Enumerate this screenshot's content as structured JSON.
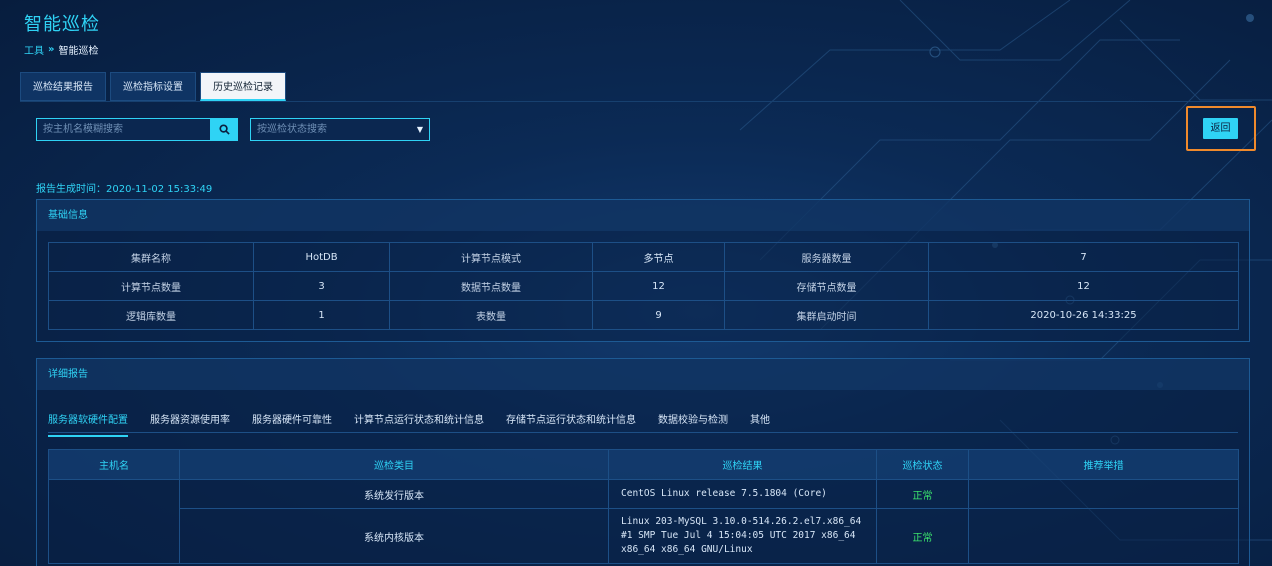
{
  "app": {
    "title": "智能巡检"
  },
  "breadcrumb": {
    "root": "工具",
    "current": "智能巡检"
  },
  "tabs": [
    {
      "label": "巡检结果报告",
      "active": false
    },
    {
      "label": "巡检指标设置",
      "active": false
    },
    {
      "label": "历史巡检记录",
      "active": true
    }
  ],
  "search": {
    "placeholder": "按主机名模糊搜索",
    "value": ""
  },
  "status_filter": {
    "placeholder": "按巡检状态搜索"
  },
  "back_label": "返回",
  "report_time": "报告生成时间：2020-11-02 15:33:49",
  "basic_info": {
    "title": "基础信息",
    "rows": [
      [
        "集群名称",
        "HotDB",
        "计算节点模式",
        "多节点",
        "服务器数量",
        "7"
      ],
      [
        "计算节点数量",
        "3",
        "数据节点数量",
        "12",
        "存储节点数量",
        "12"
      ],
      [
        "逻辑库数量",
        "1",
        "表数量",
        "9",
        "集群启动时间",
        "2020-10-26 14:33:25"
      ]
    ]
  },
  "detail": {
    "title": "详细报告",
    "sub_tabs": [
      {
        "label": "服务器软硬件配置",
        "active": true
      },
      {
        "label": "服务器资源使用率",
        "active": false
      },
      {
        "label": "服务器硬件可靠性",
        "active": false
      },
      {
        "label": "计算节点运行状态和统计信息",
        "active": false
      },
      {
        "label": "存储节点运行状态和统计信息",
        "active": false
      },
      {
        "label": "数据校验与检测",
        "active": false
      },
      {
        "label": "其他",
        "active": false
      }
    ],
    "columns": [
      "主机名",
      "巡检类目",
      "巡检结果",
      "巡检状态",
      "推荐举措"
    ],
    "rows": [
      {
        "host": "",
        "category": "系统发行版本",
        "result": "CentOS Linux release 7.5.1804 (Core)",
        "status": "正常",
        "recommend": ""
      },
      {
        "host": "",
        "category": "系统内核版本",
        "result": "Linux 203-MySQL 3.10.0-514.26.2.el7.x86_64 #1 SMP Tue Jul 4 15:04:05 UTC 2017 x86_64 x86_64 x86_64 GNU/Linux",
        "status": "正常",
        "recommend": ""
      }
    ]
  },
  "colors": {
    "accent": "#2fd3f5",
    "ok": "#3be36d",
    "highlight": "#f08a2c",
    "background": "#0b2a55"
  }
}
